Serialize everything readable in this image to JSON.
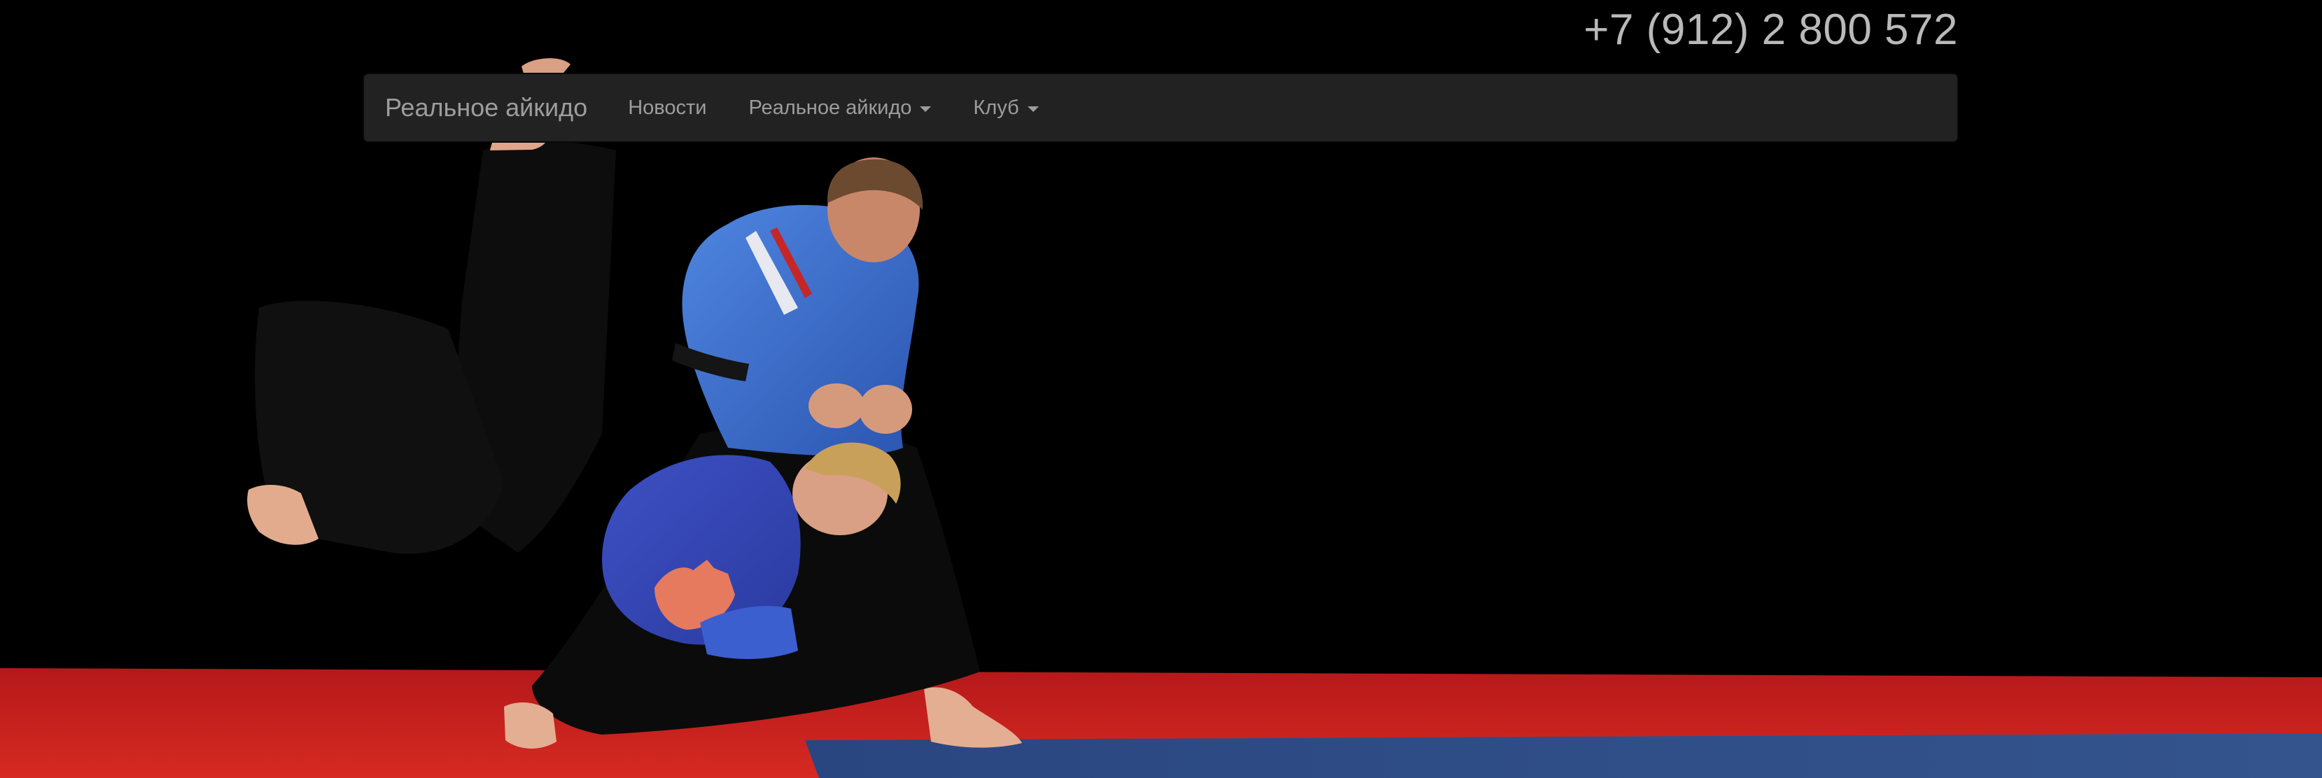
{
  "header": {
    "phone": "+7 (912) 2 800 572"
  },
  "navbar": {
    "brand": "Реальное айкидо",
    "items": [
      {
        "label": "Новости",
        "dropdown": false
      },
      {
        "label": "Реальное айкидо",
        "dropdown": true
      },
      {
        "label": "Клуб",
        "dropdown": true
      }
    ]
  },
  "hero": {
    "image_subject": "aikido-throw-photo",
    "colors": {
      "background": "#000000",
      "mat_red": "#c8201c",
      "mat_blue": "#2f4d86",
      "gi_blue": "#3a66c8",
      "hakama_black": "#0c0c0c"
    }
  }
}
